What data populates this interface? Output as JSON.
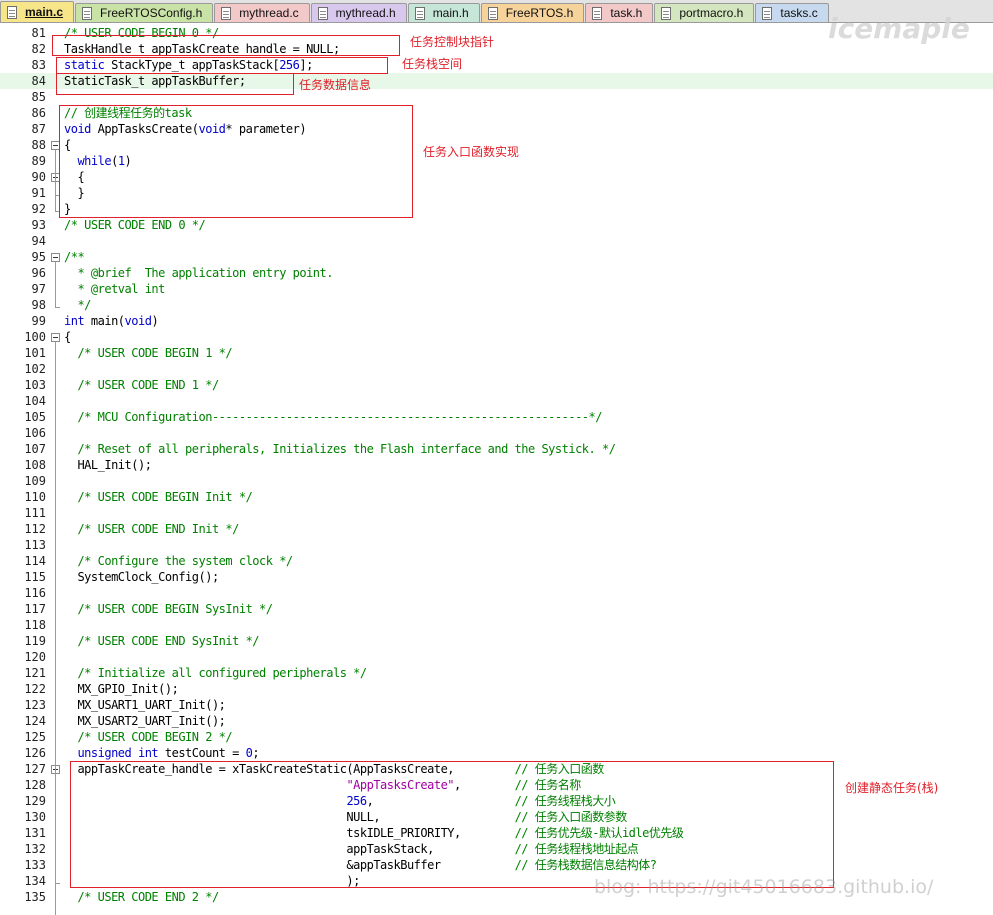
{
  "tabs": [
    {
      "label": "main.c",
      "color": "#f7e58a",
      "active": true
    },
    {
      "label": "FreeRTOSConfig.h",
      "color": "#c9e2a6",
      "active": false
    },
    {
      "label": "mythread.c",
      "color": "#f2c8c8",
      "active": false
    },
    {
      "label": "mythread.h",
      "color": "#d9c8ee",
      "active": false
    },
    {
      "label": "main.h",
      "color": "#c6e6d8",
      "active": false
    },
    {
      "label": "FreeRTOS.h",
      "color": "#f6d39a",
      "active": false
    },
    {
      "label": "task.h",
      "color": "#f2c8c8",
      "active": false
    },
    {
      "label": "portmacro.h",
      "color": "#d3e6c0",
      "active": false
    },
    {
      "label": "tasks.c",
      "color": "#c6d9ee",
      "active": false
    }
  ],
  "lines": [
    {
      "n": "81",
      "t": [
        [
          "cm",
          "/* USER CODE BEGIN 0 */"
        ]
      ]
    },
    {
      "n": "82",
      "t": [
        [
          "pl",
          "TaskHandle_t appTaskCreate_handle = NULL;"
        ]
      ]
    },
    {
      "n": "83",
      "t": [
        [
          "kw",
          "static"
        ],
        [
          "pl",
          " StackType_t appTaskStack["
        ],
        [
          "num",
          "256"
        ],
        [
          "pl",
          "];"
        ]
      ]
    },
    {
      "n": "84",
      "t": [
        [
          "pl",
          "StaticTask_t appTaskBuffer;"
        ]
      ]
    },
    {
      "n": "85",
      "t": []
    },
    {
      "n": "86",
      "t": [
        [
          "cm",
          "// 创建线程任务的task"
        ]
      ]
    },
    {
      "n": "87",
      "t": [
        [
          "kw",
          "void"
        ],
        [
          "pl",
          " AppTasksCreate("
        ],
        [
          "kw",
          "void"
        ],
        [
          "pl",
          "* parameter)"
        ]
      ]
    },
    {
      "n": "88",
      "t": [
        [
          "pl",
          "{"
        ]
      ]
    },
    {
      "n": "89",
      "t": [
        [
          "pl",
          "  "
        ],
        [
          "kw",
          "while"
        ],
        [
          "pl",
          "("
        ],
        [
          "num",
          "1"
        ],
        [
          "pl",
          ")"
        ]
      ]
    },
    {
      "n": "90",
      "t": [
        [
          "pl",
          "  {"
        ]
      ]
    },
    {
      "n": "91",
      "t": [
        [
          "pl",
          "  }"
        ]
      ]
    },
    {
      "n": "92",
      "t": [
        [
          "pl",
          "}"
        ]
      ]
    },
    {
      "n": "93",
      "t": [
        [
          "cm",
          "/* USER CODE END 0 */"
        ]
      ]
    },
    {
      "n": "94",
      "t": []
    },
    {
      "n": "95",
      "t": [
        [
          "cm",
          "/**"
        ]
      ]
    },
    {
      "n": "96",
      "t": [
        [
          "cm",
          "  * @brief  The application entry point."
        ]
      ]
    },
    {
      "n": "97",
      "t": [
        [
          "cm",
          "  * @retval int"
        ]
      ]
    },
    {
      "n": "98",
      "t": [
        [
          "cm",
          "  */"
        ]
      ]
    },
    {
      "n": "99",
      "t": [
        [
          "kw",
          "int"
        ],
        [
          "pl",
          " main("
        ],
        [
          "kw",
          "void"
        ],
        [
          "pl",
          ")"
        ]
      ]
    },
    {
      "n": "100",
      "t": [
        [
          "pl",
          "{"
        ]
      ]
    },
    {
      "n": "101",
      "t": [
        [
          "pl",
          "  "
        ],
        [
          "cm",
          "/* USER CODE BEGIN 1 */"
        ]
      ]
    },
    {
      "n": "102",
      "t": []
    },
    {
      "n": "103",
      "t": [
        [
          "pl",
          "  "
        ],
        [
          "cm",
          "/* USER CODE END 1 */"
        ]
      ]
    },
    {
      "n": "104",
      "t": []
    },
    {
      "n": "105",
      "t": [
        [
          "pl",
          "  "
        ],
        [
          "cm",
          "/* MCU Configuration--------------------------------------------------------*/"
        ]
      ]
    },
    {
      "n": "106",
      "t": []
    },
    {
      "n": "107",
      "t": [
        [
          "pl",
          "  "
        ],
        [
          "cm",
          "/* Reset of all peripherals, Initializes the Flash interface and the Systick. */"
        ]
      ]
    },
    {
      "n": "108",
      "t": [
        [
          "pl",
          "  HAL_Init();"
        ]
      ]
    },
    {
      "n": "109",
      "t": []
    },
    {
      "n": "110",
      "t": [
        [
          "pl",
          "  "
        ],
        [
          "cm",
          "/* USER CODE BEGIN Init */"
        ]
      ]
    },
    {
      "n": "111",
      "t": []
    },
    {
      "n": "112",
      "t": [
        [
          "pl",
          "  "
        ],
        [
          "cm",
          "/* USER CODE END Init */"
        ]
      ]
    },
    {
      "n": "113",
      "t": []
    },
    {
      "n": "114",
      "t": [
        [
          "pl",
          "  "
        ],
        [
          "cm",
          "/* Configure the system clock */"
        ]
      ]
    },
    {
      "n": "115",
      "t": [
        [
          "pl",
          "  SystemClock_Config();"
        ]
      ]
    },
    {
      "n": "116",
      "t": []
    },
    {
      "n": "117",
      "t": [
        [
          "pl",
          "  "
        ],
        [
          "cm",
          "/* USER CODE BEGIN SysInit */"
        ]
      ]
    },
    {
      "n": "118",
      "t": []
    },
    {
      "n": "119",
      "t": [
        [
          "pl",
          "  "
        ],
        [
          "cm",
          "/* USER CODE END SysInit */"
        ]
      ]
    },
    {
      "n": "120",
      "t": []
    },
    {
      "n": "121",
      "t": [
        [
          "pl",
          "  "
        ],
        [
          "cm",
          "/* Initialize all configured peripherals */"
        ]
      ]
    },
    {
      "n": "122",
      "t": [
        [
          "pl",
          "  MX_GPIO_Init();"
        ]
      ]
    },
    {
      "n": "123",
      "t": [
        [
          "pl",
          "  MX_USART1_UART_Init();"
        ]
      ]
    },
    {
      "n": "124",
      "t": [
        [
          "pl",
          "  MX_USART2_UART_Init();"
        ]
      ]
    },
    {
      "n": "125",
      "t": [
        [
          "pl",
          "  "
        ],
        [
          "cm",
          "/* USER CODE BEGIN 2 */"
        ]
      ]
    },
    {
      "n": "126",
      "t": [
        [
          "pl",
          "  "
        ],
        [
          "kw",
          "unsigned int"
        ],
        [
          "pl",
          " testCount = "
        ],
        [
          "num",
          "0"
        ],
        [
          "pl",
          ";"
        ]
      ]
    },
    {
      "n": "127",
      "t": [
        [
          "pl",
          "  appTaskCreate_handle = xTaskCreateStatic(AppTasksCreate,         "
        ],
        [
          "cm",
          "// 任务入口函数"
        ]
      ]
    },
    {
      "n": "128",
      "t": [
        [
          "pl",
          "                                          "
        ],
        [
          "str",
          "\"AppTasksCreate\""
        ],
        [
          "pl",
          ",        "
        ],
        [
          "cm",
          "// 任务名称"
        ]
      ]
    },
    {
      "n": "129",
      "t": [
        [
          "pl",
          "                                          "
        ],
        [
          "num",
          "256"
        ],
        [
          "pl",
          ",                     "
        ],
        [
          "cm",
          "// 任务线程栈大小"
        ]
      ]
    },
    {
      "n": "130",
      "t": [
        [
          "pl",
          "                                          NULL,                    "
        ],
        [
          "cm",
          "// 任务入口函数参数"
        ]
      ]
    },
    {
      "n": "131",
      "t": [
        [
          "pl",
          "                                          tskIDLE_PRIORITY,        "
        ],
        [
          "cm",
          "// 任务优先级-默认idle优先级"
        ]
      ]
    },
    {
      "n": "132",
      "t": [
        [
          "pl",
          "                                          appTaskStack,            "
        ],
        [
          "cm",
          "// 任务线程栈地址起点"
        ]
      ]
    },
    {
      "n": "133",
      "t": [
        [
          "pl",
          "                                          &appTaskBuffer           "
        ],
        [
          "cm",
          "// 任务栈数据信息结构体?"
        ]
      ]
    },
    {
      "n": "134",
      "t": [
        [
          "pl",
          "                                          );"
        ]
      ]
    },
    {
      "n": "135",
      "t": [
        [
          "pl",
          "  "
        ],
        [
          "cm",
          "/* USER CODE END 2 */"
        ]
      ]
    }
  ],
  "annotations": {
    "handle": "任务控制块指针",
    "stack": "任务栈空间",
    "buffer": "任务数据信息",
    "entry": "任务入口函数实现",
    "create": "创建静态任务(栈)"
  },
  "watermarks": {
    "brand": "icemaple",
    "blog": "blog: https://git45016683.github.io/"
  },
  "colors": {
    "annotation_red": "#e0202a",
    "comment_green": "#008000",
    "keyword_blue": "#0000cc",
    "string_purple": "#a000a0",
    "current_line": "#e8f8e8"
  }
}
